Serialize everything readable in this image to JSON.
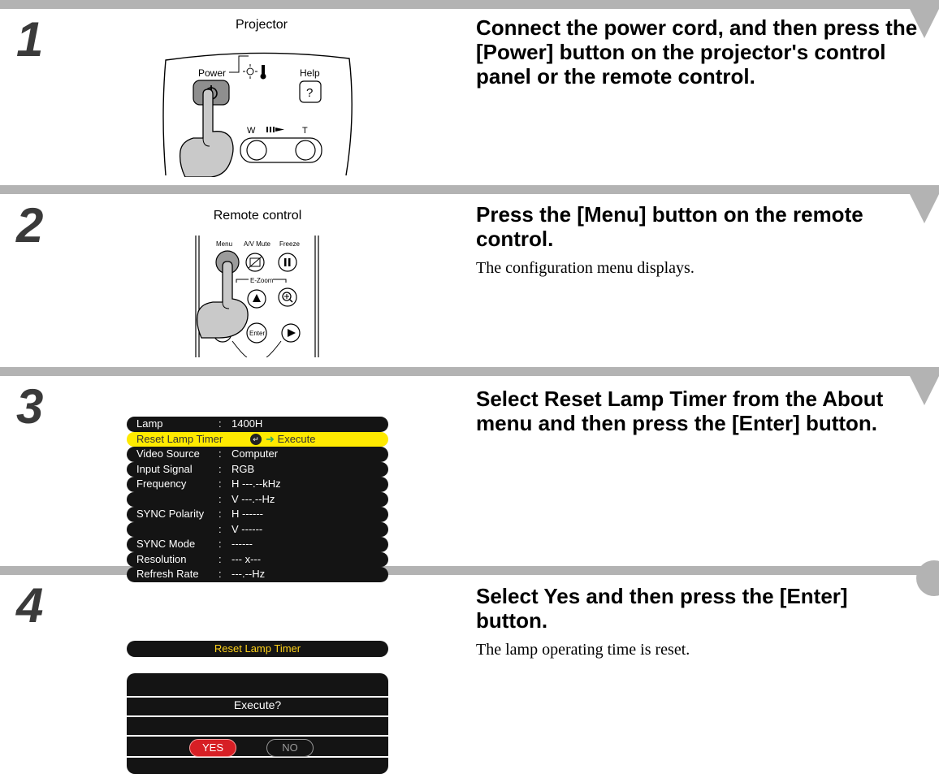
{
  "steps": [
    {
      "number": "1",
      "caption": "Projector",
      "heading": "Connect the power cord, and then press the [Power] button on the projector's control panel or the remote control.",
      "description": "",
      "panel_labels": {
        "power": "Power",
        "help": "Help",
        "help_symbol": "?",
        "wide": "W",
        "tele": "T"
      }
    },
    {
      "number": "2",
      "caption": "Remote control",
      "heading": "Press the [Menu] button on the remote control.",
      "description": "The configuration menu displays.",
      "remote_labels": {
        "menu": "Menu",
        "av_mute": "A/V Mute",
        "freeze": "Freeze",
        "ezoom": "E-Zoom",
        "enter": "Enter"
      }
    },
    {
      "number": "3",
      "heading": "Select Reset Lamp Timer from the About menu and then press the [Enter] button.",
      "description": "",
      "menu": {
        "rows": [
          {
            "label": "Lamp",
            "sep": ":",
            "value": "1400H"
          },
          {
            "label": "Reset Lamp Timer",
            "sep": "",
            "value": "Execute",
            "selected": true
          },
          {
            "label": "Video Source",
            "sep": ":",
            "value": "Computer"
          },
          {
            "label": "Input Signal",
            "sep": ":",
            "value": "RGB"
          },
          {
            "label": "Frequency",
            "sep": ":",
            "value": "H ---.--kHz"
          },
          {
            "label": "",
            "sep": ":",
            "value": "V ---.--Hz"
          },
          {
            "label": "SYNC Polarity",
            "sep": ":",
            "value": "H ------"
          },
          {
            "label": "",
            "sep": ":",
            "value": "V ------"
          },
          {
            "label": "SYNC Mode",
            "sep": ":",
            "value": "------"
          },
          {
            "label": "Resolution",
            "sep": ":",
            "value": "--- x---"
          },
          {
            "label": "Refresh Rate",
            "sep": ":",
            "value": "---.--Hz"
          }
        ]
      }
    },
    {
      "number": "4",
      "heading": "Select Yes and then press the [Enter] button.",
      "description": "The lamp operating time is reset.",
      "dialog": {
        "title": "Reset Lamp Timer",
        "question": "Execute?",
        "yes": "YES",
        "no": "NO"
      }
    }
  ],
  "colors": {
    "band": "#b3b3b3",
    "menu_bg": "#141414",
    "highlight": "#ffea00",
    "yes_button": "#d71f25"
  }
}
